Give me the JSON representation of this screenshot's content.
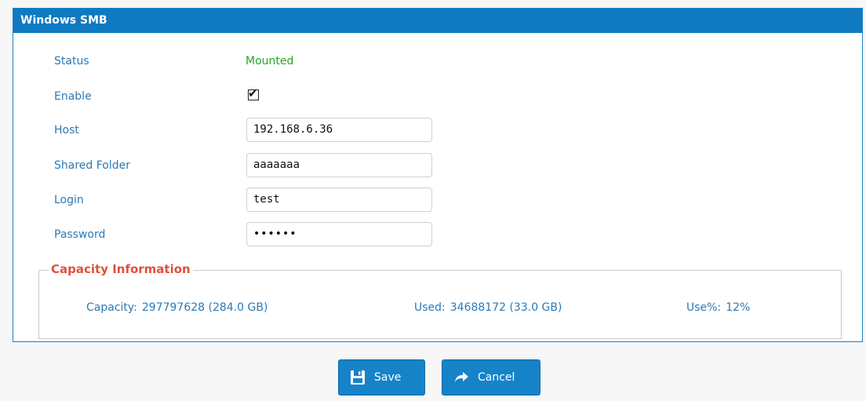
{
  "panel": {
    "title": "Windows SMB"
  },
  "form": {
    "status": {
      "label": "Status",
      "value": "Mounted"
    },
    "enable": {
      "label": "Enable",
      "checked": true,
      "check_glyph": "✔"
    },
    "host": {
      "label": "Host",
      "value": "192.168.6.36"
    },
    "shared_folder": {
      "label": "Shared Folder",
      "value": "aaaaaaa"
    },
    "login": {
      "label": "Login",
      "value": "test"
    },
    "password": {
      "label": "Password",
      "value": "••••••"
    }
  },
  "capacity": {
    "legend": "Capacity Information",
    "capacity_label": "Capacity:",
    "capacity_value": "297797628 (284.0 GB)",
    "used_label": "Used:",
    "used_value": "34688172 (33.0 GB)",
    "usepct_label": "Use%:",
    "usepct_value": "12%"
  },
  "buttons": {
    "save": {
      "label": "Save",
      "icon": "floppy-disk-icon"
    },
    "cancel": {
      "label": "Cancel",
      "icon": "arrow-right-icon"
    }
  },
  "colors": {
    "header": "#0f7ac2",
    "label": "#2a7ab8",
    "status_ok": "#26a626",
    "legend": "#e0503a",
    "button": "#1683c9"
  }
}
